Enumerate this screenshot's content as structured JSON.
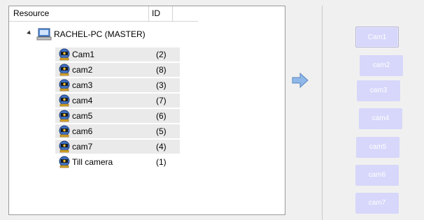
{
  "tree": {
    "columns": {
      "resource": "Resource",
      "id": "ID"
    },
    "server": {
      "label": "RACHEL-PC (MASTER)"
    },
    "cameras": [
      {
        "name": "Cam1",
        "id": "(2)"
      },
      {
        "name": "cam2",
        "id": "(8)"
      },
      {
        "name": "cam3",
        "id": "(3)"
      },
      {
        "name": "cam4",
        "id": "(7)"
      },
      {
        "name": "cam5",
        "id": "(6)"
      },
      {
        "name": "cam6",
        "id": "(5)"
      },
      {
        "name": "cam7",
        "id": "(4)"
      },
      {
        "name": "Till camera",
        "id": "(1)"
      }
    ]
  },
  "arrow_icon": "right-arrow-icon",
  "buttons": [
    "Cam1",
    "cam2",
    "cam3",
    "cam4",
    "cam5",
    "cam6",
    "cam7"
  ],
  "colors": {
    "button_bg": "#d7d7fb",
    "arrow": "#8fb8e8",
    "selection": "#eaeaea"
  }
}
